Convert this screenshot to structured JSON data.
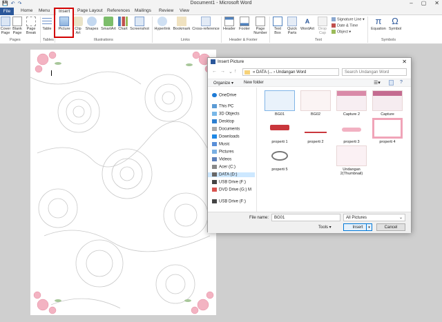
{
  "window": {
    "title": "Document1 - Microsoft Word"
  },
  "tabs": {
    "file": "File",
    "home": "Home",
    "menu": "Menu",
    "insert": "Insert",
    "page_layout": "Page Layout",
    "references": "References",
    "mailings": "Mailings",
    "review": "Review",
    "view": "View"
  },
  "ribbon": {
    "cover_page": "Cover Page",
    "blank_page": "Blank Page",
    "page_break": "Page Break",
    "table": "Table",
    "picture": "Picture",
    "clip_art": "Clip Art",
    "shapes": "Shapes",
    "smartart": "SmartArt",
    "chart": "Chart",
    "screenshot": "Screenshot",
    "hyperlink": "Hyperlink",
    "bookmark": "Bookmark",
    "cross_reference": "Cross-reference",
    "header": "Header",
    "footer": "Footer",
    "page_number": "Page Number",
    "text_box": "Text Box",
    "quick_parts": "Quick Parts",
    "wordart": "WordArt",
    "drop_cap": "Drop Cap",
    "signature_line": "Signature Line",
    "date_time": "Date & Time",
    "object": "Object",
    "equation": "Equation",
    "symbol": "Symbol",
    "groups": {
      "pages": "Pages",
      "tables": "Tables",
      "illustrations": "Illustrations",
      "links": "Links",
      "header_footer": "Header & Footer",
      "text": "Text",
      "symbols": "Symbols"
    }
  },
  "dialog": {
    "title": "Insert Picture",
    "address": "« DATA (... › Undangan Word",
    "search_placeholder": "Search Undangan Word",
    "organize": "Organize ▾",
    "new_folder": "New folder",
    "nav": [
      "OneDrive",
      "This PC",
      "3D Objects",
      "Desktop",
      "Documents",
      "Downloads",
      "Music",
      "Pictures",
      "Videos",
      "Acer (C:)",
      "DATA (D:)",
      "USB Drive (F:)",
      "DVD Drive (G:) M",
      "USB Drive (F:)"
    ],
    "files": [
      "BG01",
      "BG02",
      "Capture 2",
      "Capture",
      "properti 1",
      "properti 2",
      "properti 3",
      "properti 4",
      "properti 5",
      "Undangan 2(Thumbnail)"
    ],
    "file_name_label": "File name:",
    "file_name": "BG01",
    "file_type": "All Pictures",
    "tools": "Tools",
    "insert": "Insert",
    "cancel": "Cancel"
  }
}
